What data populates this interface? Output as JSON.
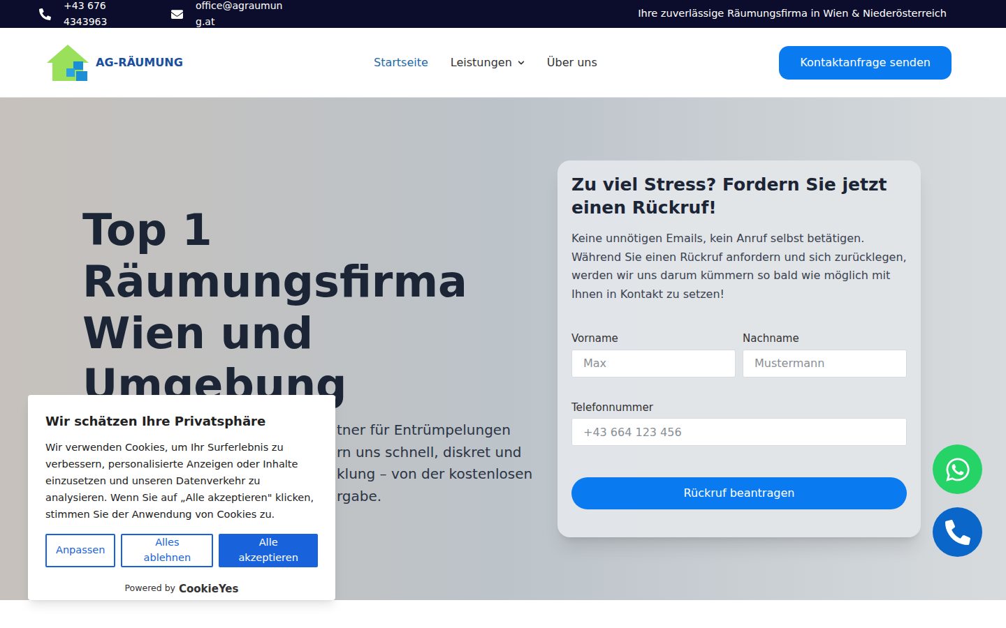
{
  "topbar": {
    "phone": "+43 676 4343963",
    "email": "office@agraumung.at",
    "tagline": "Ihre zuverlässige Räumungsfirma in Wien & Niederösterreich"
  },
  "nav": {
    "logo": "AG-RÄUMUNG",
    "links": [
      {
        "label": "Startseite",
        "selected": true,
        "dropdown": false
      },
      {
        "label": "Leistungen",
        "selected": false,
        "dropdown": true
      },
      {
        "label": "Über uns",
        "selected": false,
        "dropdown": false
      }
    ],
    "cta": "Kontaktanfrage senden"
  },
  "hero": {
    "heading": "Top 1 Räumungsfirma Wien und Umgebung",
    "paragraph_lines": [
      "tner für Entrümpelungen",
      "rn uns schnell, diskret und",
      "klung – von der kostenlosen",
      "rgabe."
    ]
  },
  "form": {
    "title": "Zu viel Stress? Fordern Sie jetzt einen Rückruf!",
    "text": "Keine unnötigen Emails, kein Anruf selbst betätigen. Während Sie einen Rückruf anfordern und sich zurücklegen, werden wir uns darum kümmern so bald wie möglich mit Ihnen in Kontakt zu setzen!",
    "fields": [
      {
        "label": "Vorname",
        "placeholder": "Max"
      },
      {
        "label": "Nachname",
        "placeholder": "Mustermann"
      },
      {
        "label": "Telefonnummer",
        "placeholder": "+43 664 123 456"
      }
    ],
    "submit": "Rückruf beantragen"
  },
  "cookie": {
    "title": "Wir schätzen Ihre Privatsphäre",
    "text": "Wir verwenden Cookies, um Ihr Surferlebnis zu verbessern, personalisierte Anzeigen oder Inhalte einzusetzen und unseren Datenverkehr zu analysieren. Wenn Sie auf „Alle akzeptieren\" klicken, stimmen Sie der Anwendung von Cookies zu.",
    "buttons": [
      {
        "label": "Anpassen",
        "primary": false
      },
      {
        "label": "Alles ablehnen",
        "primary": false
      },
      {
        "label": "Alle akzeptieren",
        "primary": true
      }
    ],
    "powered_by": "Powered by",
    "brand": "CookieYes"
  }
}
